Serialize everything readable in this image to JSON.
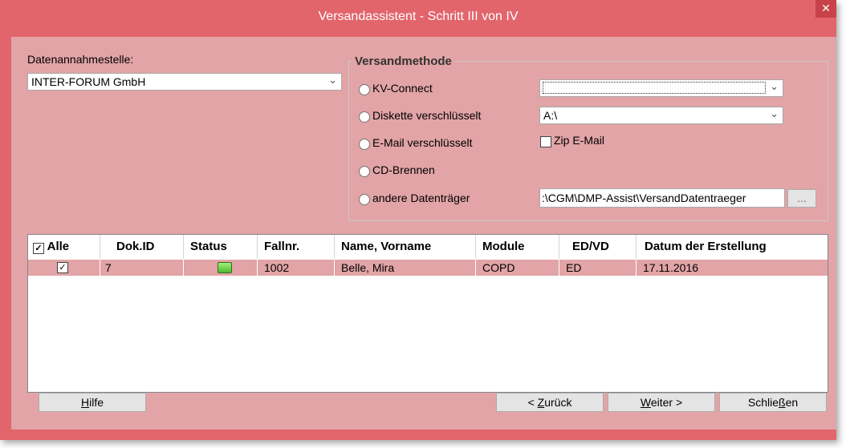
{
  "window": {
    "title": "Versandassistent - Schritt III von IV",
    "close_glyph": "✕"
  },
  "receiver": {
    "label": "Datenannahmestelle:",
    "value": "INTER-FORUM GmbH",
    "arrow": "⌄"
  },
  "method": {
    "title": "Versandmethode",
    "options": [
      {
        "label": "KV-Connect"
      },
      {
        "label": "Diskette verschlüsselt"
      },
      {
        "label": "E-Mail verschlüsselt"
      },
      {
        "label": "CD-Brennen"
      },
      {
        "label": "andere Datenträger"
      }
    ],
    "kv_connect_value": "",
    "disk_value": "A:\\",
    "zip_email_label": "Zip E-Mail",
    "zip_email_checked": false,
    "path_value": ":\\CGM\\DMP-Assist\\VersandDatentraeger",
    "browse_label": "..."
  },
  "table": {
    "select_all_label": "Alle",
    "select_all_checked": true,
    "columns": [
      "Dok.ID",
      "Status",
      "Fallnr.",
      "Name, Vorname",
      "Module",
      "ED/VD",
      "Datum der Erstellung"
    ],
    "rows": [
      {
        "checked": true,
        "check_glyph": "✓",
        "dok_id": "7",
        "status": "ok",
        "fallnr": "1002",
        "name": "Belle, Mira",
        "module": "COPD",
        "edvd": "ED",
        "datum": "17.11.2016"
      }
    ]
  },
  "buttons": {
    "help_mnemonic": "H",
    "help_rest": "ilfe",
    "back_prefix": "< ",
    "back_mnemonic": "Z",
    "back_rest": "urück",
    "next_mnemonic": "W",
    "next_rest": "eiter >",
    "close_prefix": "Schlie",
    "close_mnemonic": "ß",
    "close_rest": "en"
  },
  "colors": {
    "frame": "#e2656c",
    "client": "#e2a4a6",
    "status_ok": "#6cd44a"
  }
}
